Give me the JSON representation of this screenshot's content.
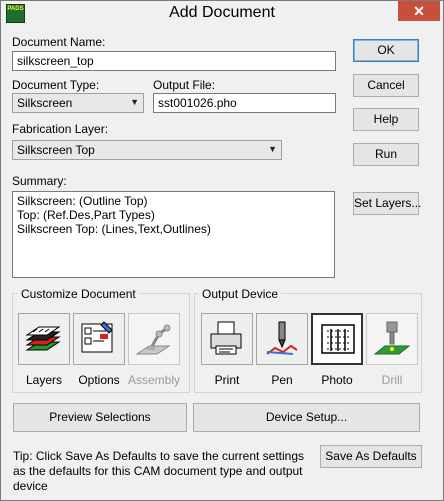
{
  "window": {
    "title": "Add Document",
    "app_icon_text": "PADS",
    "close_glyph": "✕"
  },
  "form": {
    "document_name_label": "Document Name:",
    "document_name_value": "silkscreen_top",
    "document_type_label": "Document Type:",
    "document_type_value": "Silkscreen",
    "output_file_label": "Output File:",
    "output_file_value": "sst001026.pho",
    "fabrication_layer_label": "Fabrication Layer:",
    "fabrication_layer_value": "Silkscreen Top",
    "summary_label": "Summary:",
    "summary_lines": [
      "Silkscreen: (Outline Top)",
      "Top: (Ref.Des,Part Types)",
      "Silkscreen Top: (Lines,Text,Outlines)"
    ]
  },
  "buttons": {
    "ok": "OK",
    "cancel": "Cancel",
    "help": "Help",
    "run": "Run",
    "set_layers": "Set Layers...",
    "preview_selections": "Preview Selections",
    "device_setup": "Device Setup...",
    "save_as_defaults": "Save As Defaults"
  },
  "customize": {
    "title": "Customize Document",
    "items": [
      {
        "label": "Layers",
        "icon": "layers-icon",
        "enabled": true
      },
      {
        "label": "Options",
        "icon": "options-icon",
        "enabled": true
      },
      {
        "label": "Assembly",
        "icon": "assembly-icon",
        "enabled": false
      }
    ]
  },
  "output_device": {
    "title": "Output Device",
    "selected": "Photo",
    "items": [
      {
        "label": "Print",
        "icon": "printer-icon",
        "enabled": true
      },
      {
        "label": "Pen",
        "icon": "pen-plotter-icon",
        "enabled": true
      },
      {
        "label": "Photo",
        "icon": "photo-plotter-icon",
        "enabled": true
      },
      {
        "label": "Drill",
        "icon": "drill-icon",
        "enabled": false
      }
    ]
  },
  "tip": "Tip: Click Save As Defaults to save the current settings as the defaults for this CAM document type and output device",
  "colors": {
    "close_button": "#c7503c",
    "default_button_border": "#3c7fb1",
    "dialog_background": "#f0f0f0"
  }
}
